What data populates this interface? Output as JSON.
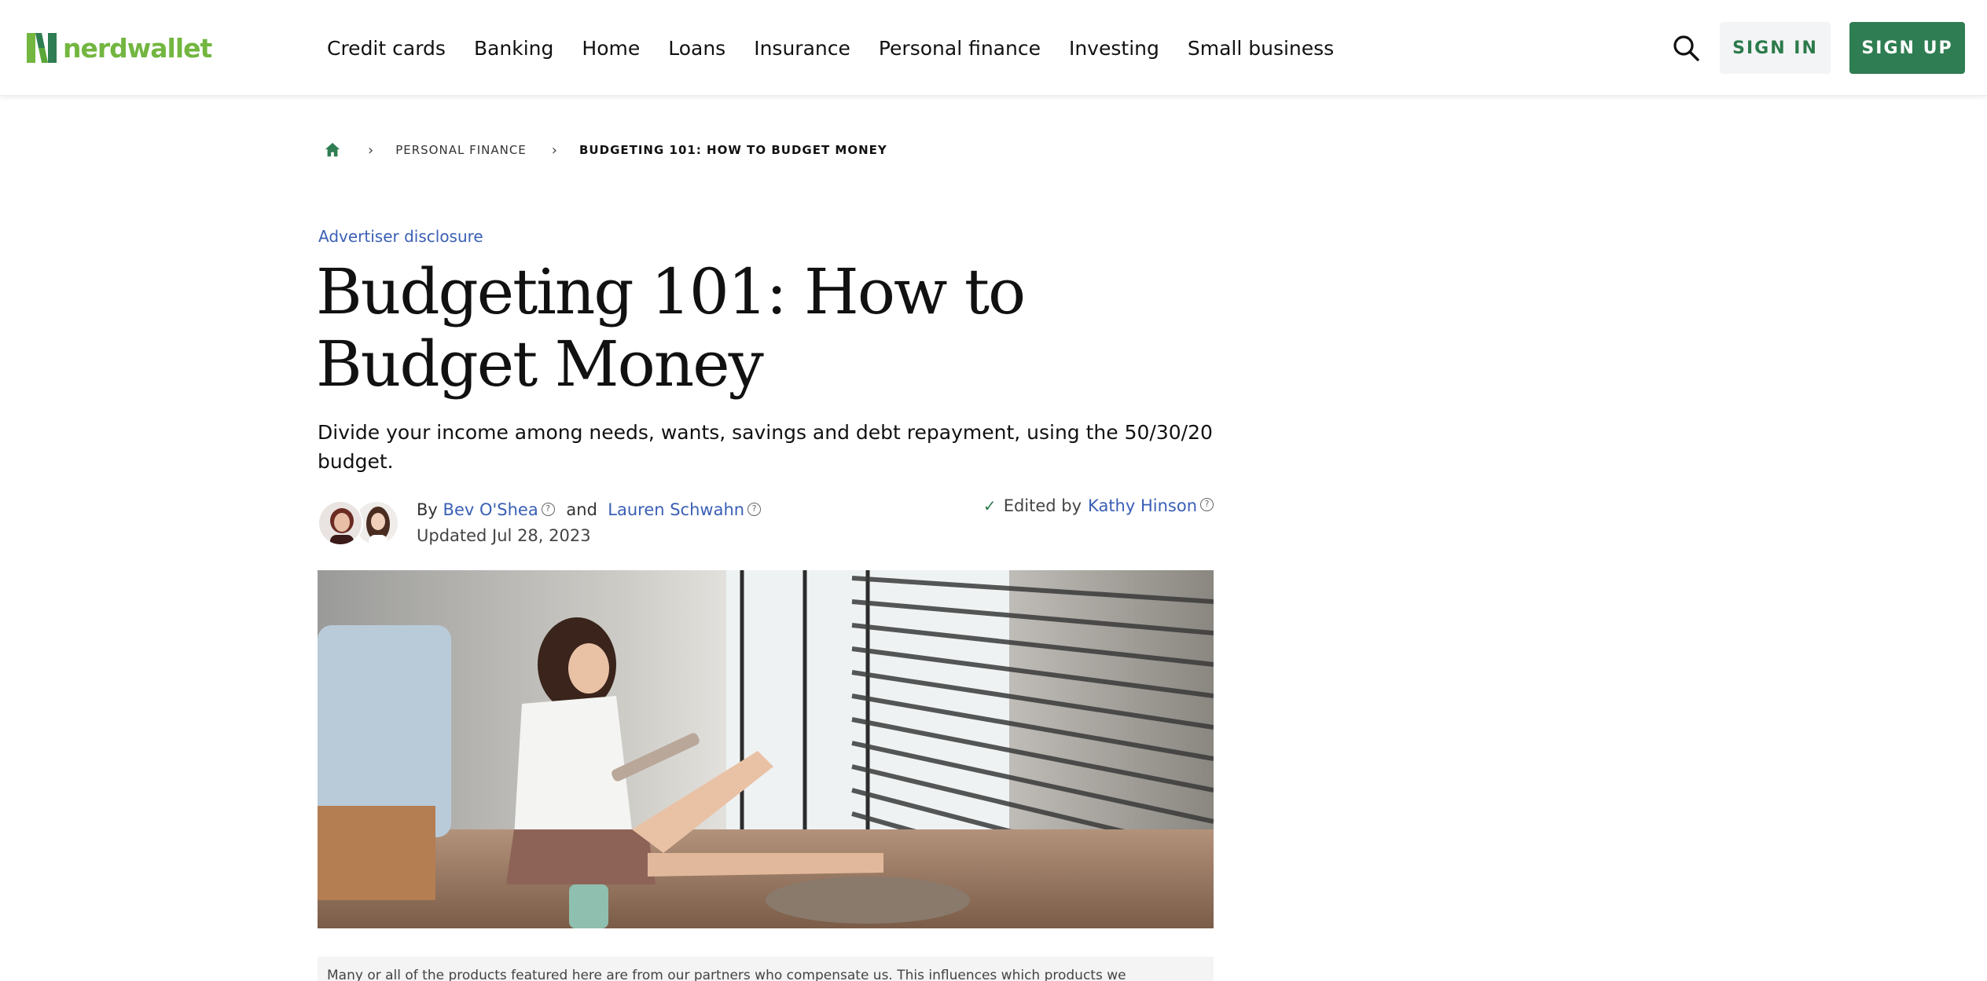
{
  "header": {
    "logo_text": "nerdwallet",
    "nav": [
      "Credit cards",
      "Banking",
      "Home",
      "Loans",
      "Insurance",
      "Personal finance",
      "Investing",
      "Small business"
    ],
    "sign_in": "SIGN IN",
    "sign_up": "SIGN UP"
  },
  "breadcrumb": {
    "items": [
      "PERSONAL FINANCE",
      "BUDGETING 101: HOW TO BUDGET MONEY"
    ]
  },
  "article": {
    "advertiser_disclosure": "Advertiser disclosure",
    "title": "Budgeting 101: How to Budget Money",
    "subtitle": "Divide your income among needs, wants, savings and debt repayment, using the 50/30/20 budget.",
    "byline_by": "By",
    "author_1": "Bev O'Shea",
    "byline_and": "and",
    "author_2": "Lauren Schwahn",
    "updated": "Updated Jul 28, 2023",
    "edited_by": "Edited by",
    "editor": "Kathy Hinson",
    "disclaimer": "Many or all of the products featured here are from our partners who compensate us. This influences which products we"
  },
  "colors": {
    "brand_green": "#73b640",
    "button_green": "#2f7d52",
    "link_blue": "#3a5fb5"
  },
  "icons": [
    "nerdwallet-logo-icon",
    "search-icon",
    "home-icon",
    "chevron-right-icon",
    "help-icon",
    "check-icon"
  ]
}
